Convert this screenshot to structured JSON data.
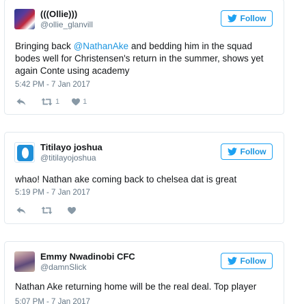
{
  "colors": {
    "link": "#1b95e0",
    "muted": "#657786",
    "text": "#14171a",
    "border": "#e1e8ed"
  },
  "follow_label": "Follow",
  "tweets": [
    {
      "display_name": "(((Ollie)))",
      "handle": "@ollie_glanvill",
      "text_before": "Bringing back ",
      "mention": "@NathanAke",
      "text_after": " and bedding him in the squad bodes well for Christensen's return in the summer, shows yet again Conte using academy",
      "timestamp": "5:42 PM - 7 Jan 2017",
      "retweets": "1",
      "likes": "1"
    },
    {
      "display_name": "Titilayo joshua",
      "handle": "@titilayojoshua",
      "text": "whao! Nathan ake coming back to chelsea dat is great",
      "timestamp": "5:19 PM - 7 Jan 2017"
    },
    {
      "display_name": "Emmy Nwadinobi CFC",
      "handle": "@damnSlick",
      "text": "Nathan Ake returning home will be the real deal. Top player",
      "timestamp": "5:07 PM - 7 Jan 2017"
    }
  ]
}
